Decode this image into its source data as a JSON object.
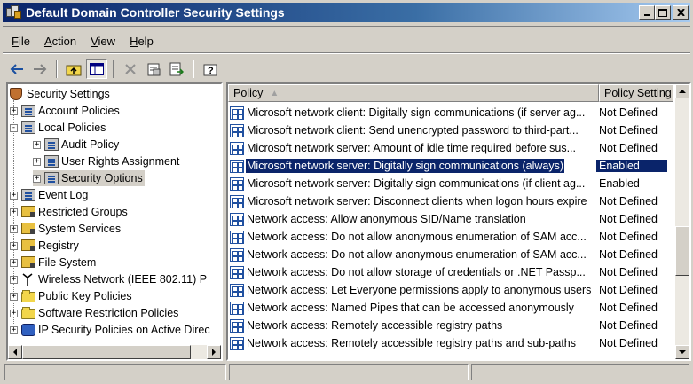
{
  "window": {
    "title": "Default Domain Controller Security Settings",
    "controls": {
      "minimize": "_",
      "maximize": "□",
      "close": "×"
    }
  },
  "menubar": {
    "items": [
      {
        "label": "File",
        "accel": "F"
      },
      {
        "label": "Action",
        "accel": "A"
      },
      {
        "label": "View",
        "accel": "V"
      },
      {
        "label": "Help",
        "accel": "H"
      }
    ]
  },
  "toolbar": {
    "icons": [
      "back-icon",
      "forward-icon",
      "up-folder-icon",
      "show-hide-tree-icon",
      "delete-icon",
      "properties-icon",
      "export-list-icon",
      "help-icon"
    ]
  },
  "tree": {
    "items": [
      {
        "label": "Security Settings",
        "icon": "security-settings-icon",
        "expander": ""
      },
      {
        "label": "Account Policies",
        "icon": "policy-folder-icon",
        "expander": "+"
      },
      {
        "label": "Local Policies",
        "icon": "policy-folder-icon",
        "expander": "-"
      },
      {
        "label": "Audit Policy",
        "icon": "policy-folder-icon",
        "expander": "+"
      },
      {
        "label": "User Rights Assignment",
        "icon": "policy-folder-icon",
        "expander": "+"
      },
      {
        "label": "Security Options",
        "icon": "policy-folder-icon",
        "expander": "+"
      },
      {
        "label": "Event Log",
        "icon": "policy-folder-icon",
        "expander": "+"
      },
      {
        "label": "Restricted Groups",
        "icon": "locked-folder-icon",
        "expander": "+"
      },
      {
        "label": "System Services",
        "icon": "locked-folder-icon",
        "expander": "+"
      },
      {
        "label": "Registry",
        "icon": "locked-folder-icon",
        "expander": "+"
      },
      {
        "label": "File System",
        "icon": "locked-folder-icon",
        "expander": "+"
      },
      {
        "label": "Wireless Network (IEEE 802.11) P",
        "icon": "antenna-icon",
        "expander": "+"
      },
      {
        "label": "Public Key Policies",
        "icon": "folder-icon",
        "expander": "+"
      },
      {
        "label": "Software Restriction Policies",
        "icon": "folder-icon",
        "expander": "+"
      },
      {
        "label": "IP Security Policies on Active Direc",
        "icon": "ipsec-icon",
        "expander": "+"
      }
    ]
  },
  "list": {
    "columns": {
      "policy": "Policy",
      "setting": "Policy Setting"
    },
    "rows": [
      {
        "policy": "Microsoft network client: Digitally sign communications (if server ag...",
        "setting": "Not Defined"
      },
      {
        "policy": "Microsoft network client: Send unencrypted password to third-part...",
        "setting": "Not Defined"
      },
      {
        "policy": "Microsoft network server: Amount of idle time required before sus...",
        "setting": "Not Defined"
      },
      {
        "policy": "Microsoft network server: Digitally sign communications (always)",
        "setting": "Enabled"
      },
      {
        "policy": "Microsoft network server: Digitally sign communications (if client ag...",
        "setting": "Enabled"
      },
      {
        "policy": "Microsoft network server: Disconnect clients when logon hours expire",
        "setting": "Not Defined"
      },
      {
        "policy": "Network access: Allow anonymous SID/Name translation",
        "setting": "Not Defined"
      },
      {
        "policy": "Network access: Do not allow anonymous enumeration of SAM acc...",
        "setting": "Not Defined"
      },
      {
        "policy": "Network access: Do not allow anonymous enumeration of SAM acc...",
        "setting": "Not Defined"
      },
      {
        "policy": "Network access: Do not allow storage of credentials or .NET Passp...",
        "setting": "Not Defined"
      },
      {
        "policy": "Network access: Let Everyone permissions apply to anonymous users",
        "setting": "Not Defined"
      },
      {
        "policy": "Network access: Named Pipes that can be accessed anonymously",
        "setting": "Not Defined"
      },
      {
        "policy": "Network access: Remotely accessible registry paths",
        "setting": "Not Defined"
      },
      {
        "policy": "Network access: Remotely accessible registry paths and sub-paths",
        "setting": "Not Defined"
      }
    ],
    "selected_index": 3
  },
  "colors": {
    "title_gradient_start": "#0a246a",
    "title_gradient_end": "#a6caf0",
    "selection": "#0a246a",
    "chrome": "#d4d0c8"
  }
}
